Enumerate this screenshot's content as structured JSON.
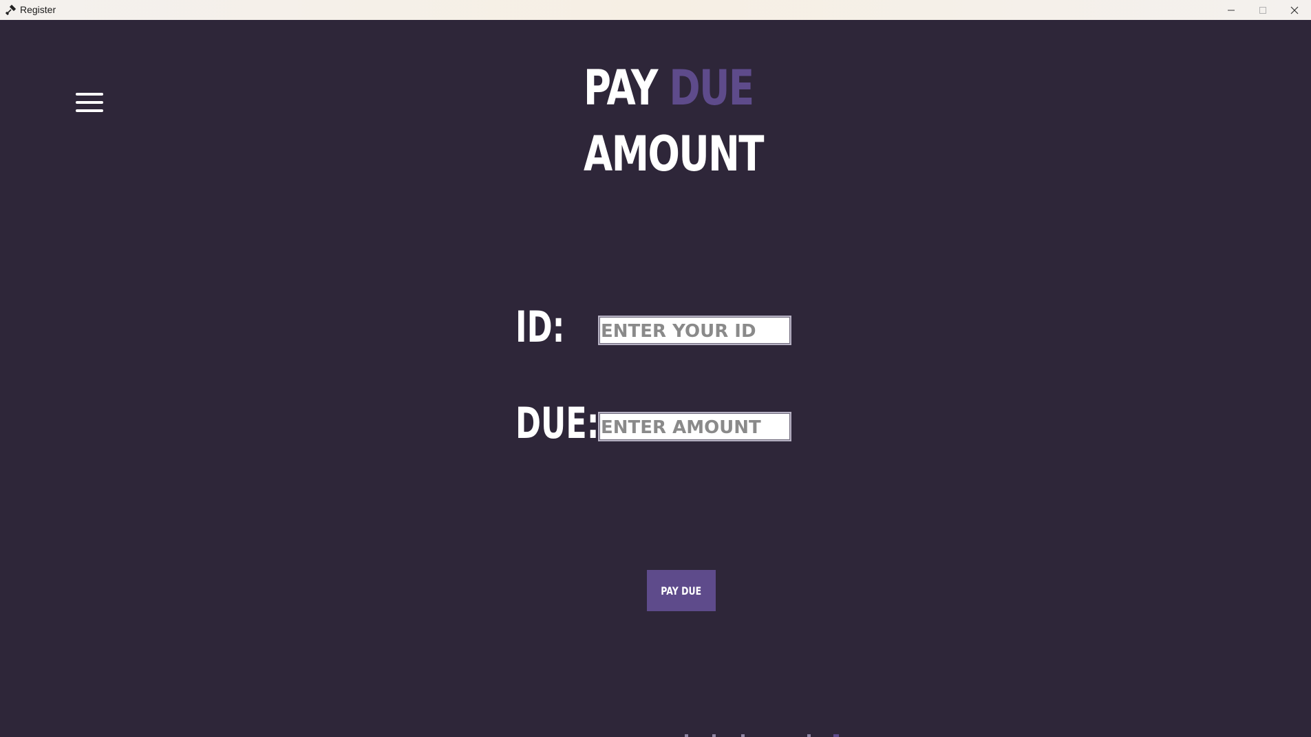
{
  "window": {
    "title": "Register",
    "controls": [
      "minimize-icon",
      "maximize-icon",
      "close-icon"
    ]
  },
  "header": {
    "title_part1": "PAY",
    "title_accent": "DUE",
    "title_line2": "AMOUNT"
  },
  "form": {
    "id_label": "ID:",
    "id_placeholder": "ENTER YOUR ID",
    "due_label": "DUE:",
    "due_placeholder": "ENTER AMOUNT",
    "submit_label": "PAY DUE"
  },
  "menu": {
    "icon": "hamburger-menu-icon"
  },
  "colors": {
    "background": "#2e2639",
    "accent": "#5e4b8b",
    "text": "#ffffff"
  }
}
